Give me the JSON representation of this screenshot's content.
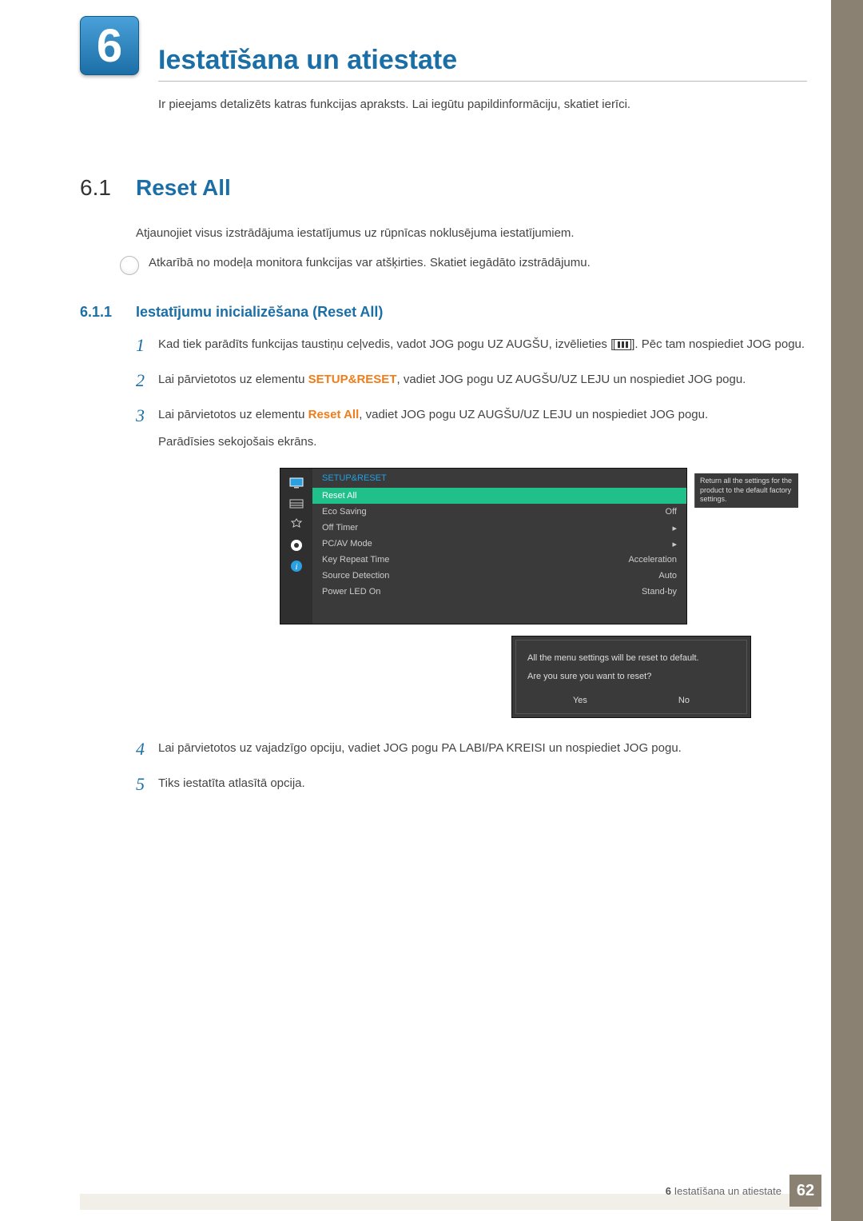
{
  "chapter": {
    "number": "6",
    "title": "Iestatīšana un atiestate",
    "subtitle": "Ir pieejams detalizēts katras funkcijas apraksts. Lai iegūtu papildinformāciju, skatiet ierīci."
  },
  "section": {
    "number": "6.1",
    "title": "Reset All",
    "para": "Atjaunojiet visus izstrādājuma iestatījumus uz rūpnīcas noklusējuma iestatījumiem.",
    "note": "Atkarībā no modeļa monitora funkcijas var atšķirties. Skatiet iegādāto izstrādājumu."
  },
  "subsection": {
    "number": "6.1.1",
    "title": "Iestatījumu inicializēšana (Reset All)"
  },
  "steps": {
    "s1a": "Kad tiek parādīts funkcijas taustiņu ceļvedis, vadot JOG pogu UZ AUGŠU, izvēlieties [",
    "s1b": "]. Pēc tam nospiediet JOG pogu.",
    "s2a": "Lai pārvietotos uz elementu ",
    "s2bold": "SETUP&RESET",
    "s2b": ", vadiet JOG pogu UZ AUGŠU/UZ LEJU un nospiediet JOG pogu.",
    "s3a": "Lai pārvietotos uz elementu ",
    "s3bold": "Reset All",
    "s3b": ", vadiet JOG pogu UZ AUGŠU/UZ LEJU un nospiediet JOG pogu.",
    "s3c": "Parādīsies sekojošais ekrāns.",
    "s4": "Lai pārvietotos uz vajadzīgo opciju, vadiet JOG pogu PA LABI/PA KREISI un nospiediet JOG pogu.",
    "s5": "Tiks iestatīta atlasītā opcija."
  },
  "stepnums": {
    "n1": "1",
    "n2": "2",
    "n3": "3",
    "n4": "4",
    "n5": "5"
  },
  "osd": {
    "header": "SETUP&RESET",
    "rows": {
      "reset": {
        "label": "Reset All",
        "val": ""
      },
      "eco": {
        "label": "Eco Saving",
        "val": "Off"
      },
      "off": {
        "label": "Off Timer",
        "val": "▸"
      },
      "pcav": {
        "label": "PC/AV Mode",
        "val": "▸"
      },
      "key": {
        "label": "Key Repeat Time",
        "val": "Acceleration"
      },
      "src": {
        "label": "Source Detection",
        "val": "Auto"
      },
      "led": {
        "label": "Power LED On",
        "val": "Stand-by"
      }
    },
    "help": "Return all the settings for the product to the default factory settings."
  },
  "dialog": {
    "line1": "All the menu settings will be reset to default.",
    "line2": "Are you sure you want to reset?",
    "yes": "Yes",
    "no": "No"
  },
  "footer": {
    "chapter": "6",
    "title": "Iestatīšana un atiestate",
    "page": "62"
  }
}
